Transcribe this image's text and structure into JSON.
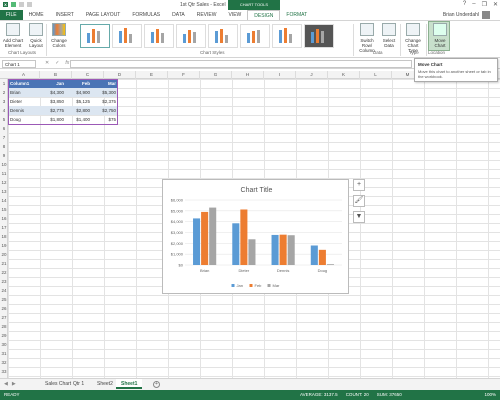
{
  "app": {
    "title": "1st Qtr Sales - Excel",
    "context_tools": "CHART TOOLS"
  },
  "user": {
    "name": "Brian Underdahl"
  },
  "tabs": [
    "FILE",
    "HOME",
    "INSERT",
    "PAGE LAYOUT",
    "FORMULAS",
    "DATA",
    "REVIEW",
    "VIEW",
    "DESIGN",
    "FORMAT"
  ],
  "ribbon": {
    "add_chart_element": "Add Chart Element",
    "quick_layout": "Quick Layout",
    "change_colors": "Change Colors",
    "switch_row_col": "Switch Row/ Column",
    "select_data": "Select Data",
    "change_chart_type": "Change Chart Type",
    "move_chart": "Move Chart",
    "groups": {
      "chart_layouts": "Chart Layouts",
      "chart_styles": "Chart Styles",
      "data": "Data",
      "type": "Type",
      "location": "Location"
    }
  },
  "tooltip": {
    "title": "Move Chart",
    "desc": "Move this chart to another sheet or tab in the workbook."
  },
  "formula_bar": {
    "name_box": "Chart 1",
    "cancel": "✕",
    "enter": "✓",
    "fx": "fx"
  },
  "columns": [
    "A",
    "B",
    "C",
    "D",
    "E",
    "F",
    "G",
    "H",
    "I",
    "J",
    "K",
    "L",
    "M",
    "N",
    "O",
    "P"
  ],
  "rows": [
    "1",
    "2",
    "3",
    "4",
    "5",
    "6",
    "7",
    "8",
    "9",
    "10",
    "11",
    "12",
    "13",
    "14",
    "15",
    "16",
    "17",
    "18",
    "19",
    "20",
    "21",
    "22",
    "23",
    "24",
    "25",
    "26",
    "27",
    "28",
    "29",
    "30",
    "31",
    "32",
    "33"
  ],
  "table": {
    "headers": [
      "Column1",
      "Jan",
      "Feb",
      "Mar"
    ],
    "rows": [
      [
        "Brian",
        "$4,300",
        "$4,900",
        "$5,300"
      ],
      [
        "Dieter",
        "$3,850",
        "$5,125",
        "$2,375"
      ],
      [
        "Dennis",
        "$2,775",
        "$2,800",
        "$2,750"
      ],
      [
        "Doug",
        "$1,800",
        "$1,400",
        "$75"
      ]
    ]
  },
  "chart_data": {
    "type": "bar",
    "title": "Chart Title",
    "categories": [
      "Brian",
      "Dieter",
      "Dennis",
      "Doug"
    ],
    "series": [
      {
        "name": "Jan",
        "values": [
          4300,
          3850,
          2775,
          1800
        ],
        "color": "#5b9bd5"
      },
      {
        "name": "Feb",
        "values": [
          4900,
          5125,
          2800,
          1400
        ],
        "color": "#ed7d31"
      },
      {
        "name": "Mar",
        "values": [
          5300,
          2375,
          2750,
          75
        ],
        "color": "#a5a5a5"
      }
    ],
    "ylim": [
      0,
      6000
    ],
    "yticks": [
      "$0",
      "$1,000",
      "$2,000",
      "$3,000",
      "$4,000",
      "$5,000",
      "$6,000"
    ],
    "grid": true,
    "legend": "bottom"
  },
  "sheets": [
    "Sales Chart",
    "Qtr 1",
    "Sheet2",
    "Sheet1"
  ],
  "status": {
    "left": "READY",
    "average": "AVERAGE: 3137.5",
    "count": "COUNT: 20",
    "sum": "SUM: 37650",
    "zoom": "100%"
  },
  "side_buttons": {
    "elements": "+",
    "styles": "🖌",
    "filters": "▼"
  }
}
